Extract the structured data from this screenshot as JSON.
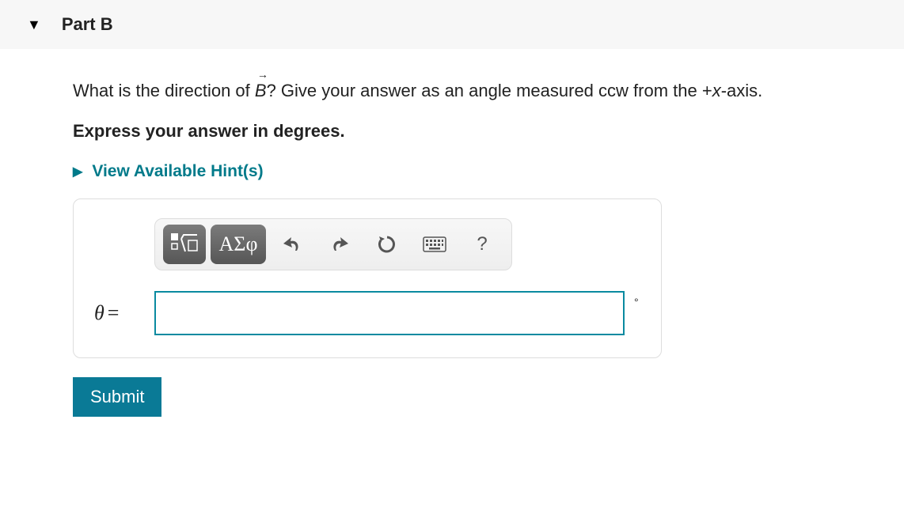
{
  "part": {
    "title": "Part B"
  },
  "question": {
    "prefix": "What is the direction of ",
    "vector_letter": "B",
    "suffix": "? Give your answer as an angle measured ccw from the ",
    "axis_plus": "+",
    "axis_letter": "x",
    "axis_suffix": "-axis."
  },
  "instruction": "Express your answer in degrees.",
  "hints": {
    "label": "View Available Hint(s)"
  },
  "toolbar": {
    "symbols_label": "ΑΣφ",
    "help_label": "?"
  },
  "answer": {
    "label_symbol": "θ",
    "label_eq": "=",
    "value": "",
    "unit": "°"
  },
  "submit": {
    "label": "Submit"
  }
}
